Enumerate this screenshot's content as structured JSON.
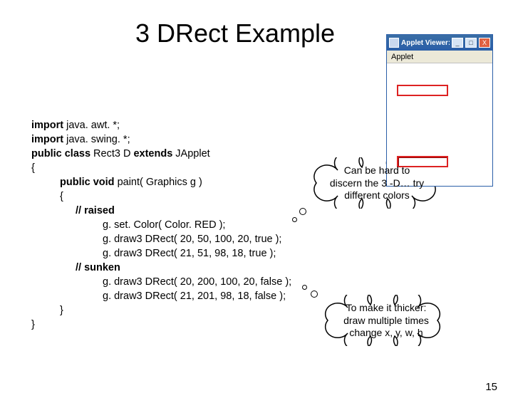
{
  "title": "3 DRect Example",
  "code": {
    "l1a": "import",
    "l1b": " java. awt. *;",
    "l2a": "import",
    "l2b": " java. swing. *;",
    "l3a": "public class ",
    "l3b": "Rect3 D ",
    "l3c": "extends",
    "l3d": " JApplet",
    "l4": "{",
    "l5a": "public void ",
    "l5b": "paint( Graphics g )",
    "l6": "{",
    "l7": "// raised",
    "l8": "g. set. Color( Color. RED );",
    "l9": "g. draw3 DRect( 20, 50, 100, 20, true );",
    "l10": "g. draw3 DRect( 21, 51,  98, 18, true );",
    "l11": "// sunken",
    "l12": "g. draw3 DRect( 20, 200, 100, 20, false );",
    "l13": "g. draw3 DRect( 21, 201,  98, 18, false );",
    "l14": "}",
    "l15": "}"
  },
  "bubble1": {
    "line1": "Can be hard to",
    "line2": "discern the 3 -D… try",
    "line3": "different colors"
  },
  "bubble2": {
    "line1": "To make it thicker:",
    "line2": "draw multiple times",
    "line3": "change x, y, w, h"
  },
  "applet": {
    "title": "Applet Viewer: …",
    "menu": "Applet",
    "btn_min": "_",
    "btn_max": "□",
    "btn_close": "X"
  },
  "pagenum": "15"
}
